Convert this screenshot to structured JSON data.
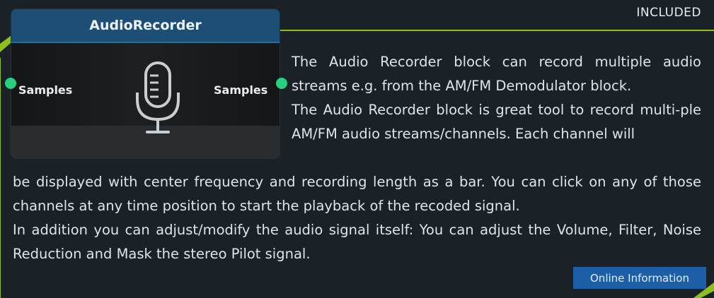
{
  "badge": "INCLUDED",
  "block": {
    "title": "AudioRecorder",
    "input_port": "Samples",
    "output_port": "Samples",
    "icon": "microphone-icon"
  },
  "description": {
    "p1": "The Audio Recorder block can record multiple audio streams e.g. from the AM/FM Demodulator block.",
    "p2": "The Audio Recorder block is great tool to record multi-ple AM/FM audio streams/channels. Each channel will",
    "p3": "be displayed with center frequency and recording length as a bar. You can click on any of those channels at any time position to start the playback of the recoded signal.",
    "p4": "In addition you can adjust/modify the audio signal itself: You can adjust the Volume, Filter, Noise Reduction and Mask the stereo Pilot signal."
  },
  "button": {
    "label": "Online Information"
  },
  "colors": {
    "accent_green": "#26d07c",
    "frame_lime": "#8fbf1f",
    "button_blue": "#1c5fa6",
    "title_blue": "#1d4e75"
  }
}
